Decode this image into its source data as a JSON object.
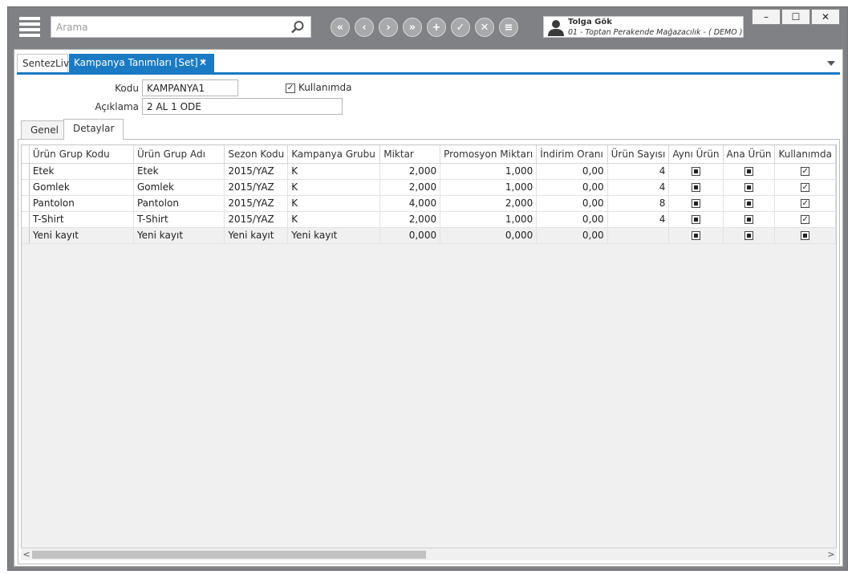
{
  "search": {
    "placeholder": "Arama"
  },
  "nav_buttons": [
    "first",
    "previous",
    "next",
    "last",
    "add",
    "save",
    "delete",
    "more"
  ],
  "user": {
    "name": "Tolga Gök",
    "company": "01 - Toptan Perakende Mağazacılık - ( DEMO )"
  },
  "window_controls": {
    "minimize": "–",
    "maximize": "☐",
    "close": "✕"
  },
  "tabs": [
    {
      "label": "SentezLive"
    },
    {
      "label": "Kampanya Tanımları  [Set] *",
      "close": "✕"
    }
  ],
  "form": {
    "kodu_label": "Kodu",
    "kodu_value": "KAMPANYA1",
    "aciklama_label": "Açıklama",
    "aciklama_value": "2 AL 1 ODE",
    "kullanimda_label": "Kullanımda",
    "kullanimda_checked": "✓"
  },
  "inner_tabs": [
    "Genel",
    "Detaylar"
  ],
  "grid": {
    "columns": [
      "Ürün Grup Kodu",
      "Ürün Grup Adı",
      "Sezon Kodu",
      "Kampanya Grubu",
      "Miktar",
      "Promosyon Miktarı",
      "İndirim Oranı",
      "Ürün Sayısı",
      "Aynı Ürün",
      "Ana Ürün",
      "Kullanımda"
    ],
    "rows": [
      {
        "kod": "Etek",
        "ad": "Etek",
        "sezon": "2015/YAZ",
        "grup": "K",
        "miktar": "2,000",
        "promo": "1,000",
        "indirim": "0,00",
        "sayi": "4",
        "check": "✓"
      },
      {
        "kod": "Gomlek",
        "ad": "Gomlek",
        "sezon": "2015/YAZ",
        "grup": "K",
        "miktar": "2,000",
        "promo": "1,000",
        "indirim": "0,00",
        "sayi": "4",
        "check": "✓"
      },
      {
        "kod": "Pantolon",
        "ad": "Pantolon",
        "sezon": "2015/YAZ",
        "grup": "K",
        "miktar": "4,000",
        "promo": "2,000",
        "indirim": "0,00",
        "sayi": "8",
        "check": "✓"
      },
      {
        "kod": "T-Shirt",
        "ad": "T-Shirt",
        "sezon": "2015/YAZ",
        "grup": "K",
        "miktar": "2,000",
        "promo": "1,000",
        "indirim": "0,00",
        "sayi": "4",
        "check": "✓"
      }
    ],
    "new_row": {
      "kod": "Yeni kayıt",
      "ad": "Yeni kayıt",
      "sezon": "Yeni kayıt",
      "grup": "Yeni kayıt",
      "miktar": "0,000",
      "promo": "0,000",
      "indirim": "0,00",
      "sayi": ""
    }
  },
  "scroll": {
    "left": "<",
    "right": ">"
  }
}
